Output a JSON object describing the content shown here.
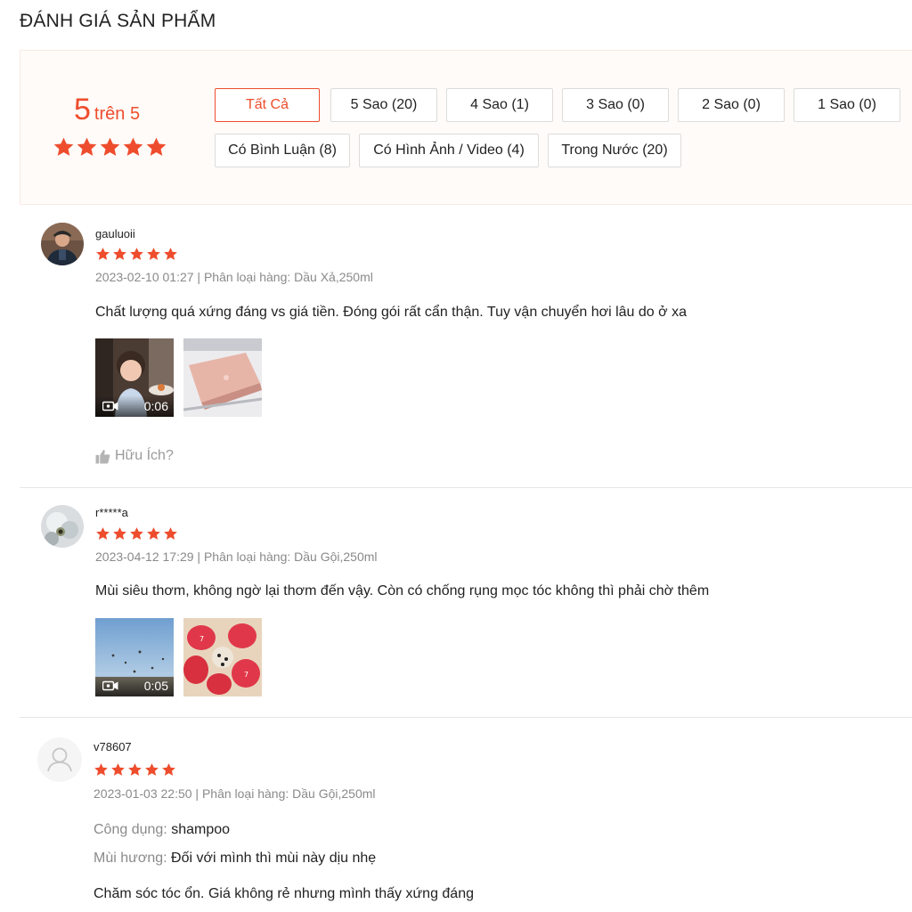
{
  "page": {
    "title": "ĐÁNH GIÁ SẢN PHẨM"
  },
  "summary": {
    "score": "5",
    "score_suffix": "trên 5",
    "stars": 5,
    "filters": [
      {
        "label": "Tất Cả",
        "active": true
      },
      {
        "label": "5 Sao (20)"
      },
      {
        "label": "4 Sao (1)"
      },
      {
        "label": "3 Sao (0)"
      },
      {
        "label": "2 Sao (0)"
      },
      {
        "label": "1 Sao (0)"
      },
      {
        "label": "Có Bình Luận (8)"
      },
      {
        "label": "Có Hình Ảnh / Video (4)"
      },
      {
        "label": "Trong Nước (20)"
      }
    ]
  },
  "reviews": [
    {
      "username": "gauluoii",
      "rating": 5,
      "meta": "2023-02-10 01:27 | Phân loại hàng: Dầu Xả,250ml",
      "comment": "Chất lượng quá xứng đáng vs giá tiền. Đóng gói rất cẩn thận. Tuy vận chuyển hơi lâu do ở xa",
      "media": [
        {
          "type": "video",
          "duration": "0:06"
        },
        {
          "type": "image"
        }
      ],
      "helpful_label": "Hữu Ích?"
    },
    {
      "username": "r*****a",
      "rating": 5,
      "meta": "2023-04-12 17:29 | Phân loại hàng: Dầu Gội,250ml",
      "comment": "Mùi siêu thơm, không ngờ lại thơm đến vậy. Còn có chống rụng mọc tóc không thì phải chờ thêm",
      "media": [
        {
          "type": "video",
          "duration": "0:05"
        },
        {
          "type": "image"
        }
      ]
    },
    {
      "username": "v78607",
      "rating": 5,
      "meta": "2023-01-03 22:50 | Phân loại hàng: Dầu Gội,250ml",
      "attributes": [
        {
          "key": "Công dụng:",
          "value": "shampoo"
        },
        {
          "key": "Mùi hương:",
          "value": "Đối với mình thì mùi này dịu nhẹ"
        }
      ],
      "comment": "Chăm sóc tóc ổn. Giá không rẻ nhưng mình thấy xứng đáng"
    }
  ],
  "colors": {
    "accent": "#ee4d2d",
    "muted": "#8a8a8a",
    "summary_bg": "#fffbf8"
  },
  "icons": {
    "star": "star-icon",
    "video": "video-camera-icon",
    "like": "thumbs-up-icon",
    "default_avatar": "user-icon"
  }
}
